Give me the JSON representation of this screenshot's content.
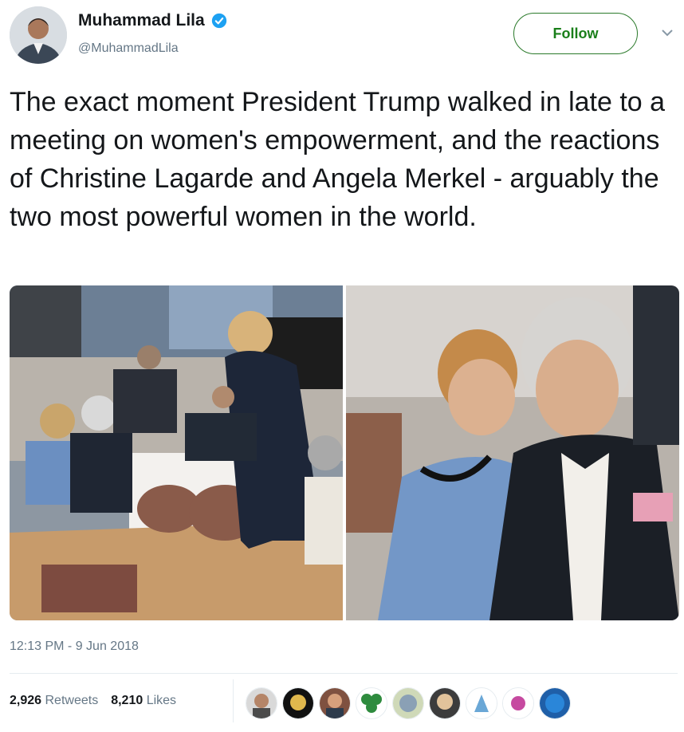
{
  "author": {
    "name": "Muhammad Lila",
    "handle": "@MuhammadLila",
    "verified_icon": "verified-badge-icon"
  },
  "actions": {
    "follow_label": "Follow",
    "more_icon": "chevron-down-icon"
  },
  "tweet": {
    "text": "The exact moment President Trump walked in late to a meeting on women's empowerment, and the reactions of Christine Lagarde and Angela Merkel - arguably the two most powerful women in the world.",
    "timestamp": "12:13 PM - 9 Jun 2018"
  },
  "stats": {
    "retweets_count": "2,926",
    "retweets_label": "Retweets",
    "likes_count": "8,210",
    "likes_label": "Likes"
  },
  "colors": {
    "accent_green": "#1a7f1a",
    "verified_blue": "#1da1f2",
    "secondary_text": "#657786"
  }
}
